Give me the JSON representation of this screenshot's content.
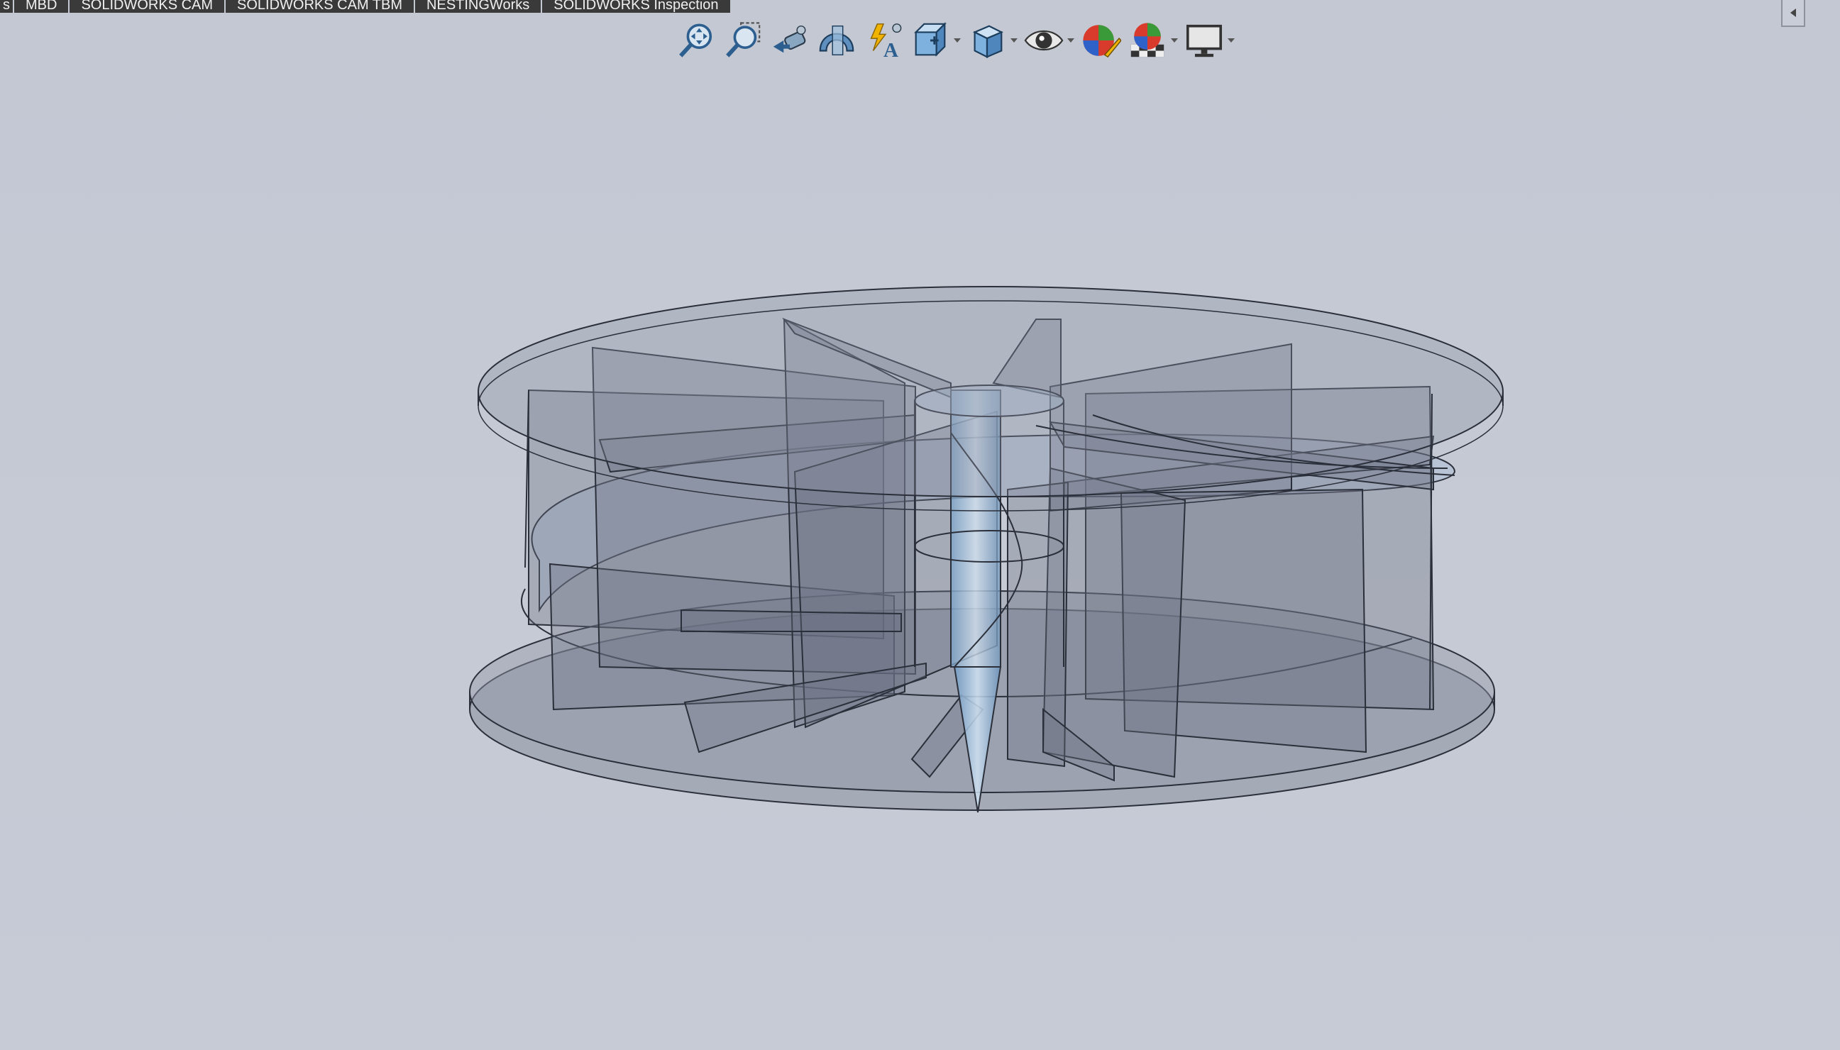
{
  "command_tabs": [
    {
      "label": "s"
    },
    {
      "label": "MBD"
    },
    {
      "label": "SOLIDWORKS CAM"
    },
    {
      "label": "SOLIDWORKS CAM TBM"
    },
    {
      "label": "NESTINGWorks"
    },
    {
      "label": "SOLIDWORKS Inspection"
    }
  ],
  "heads_up_toolbar": {
    "tools": [
      {
        "icon": "zoom-to-fit-icon"
      },
      {
        "icon": "zoom-to-area-icon"
      },
      {
        "icon": "previous-view-icon"
      },
      {
        "icon": "section-view-icon"
      },
      {
        "icon": "dynamic-annotation-views-icon"
      },
      {
        "icon": "view-orientation-icon"
      },
      {
        "icon": "display-style-icon"
      },
      {
        "icon": "hide-show-items-icon"
      },
      {
        "icon": "edit-appearance-icon"
      },
      {
        "icon": "apply-scene-icon"
      },
      {
        "icon": "view-settings-icon"
      }
    ]
  },
  "panel_toggle": {
    "icon": "collapse-arrow-icon"
  },
  "model": {
    "description_icon": "impeller-part-icon",
    "edge_color": "#2b2f3a",
    "face_color": "#7d8394",
    "accent_color": "#8fb3d6"
  }
}
